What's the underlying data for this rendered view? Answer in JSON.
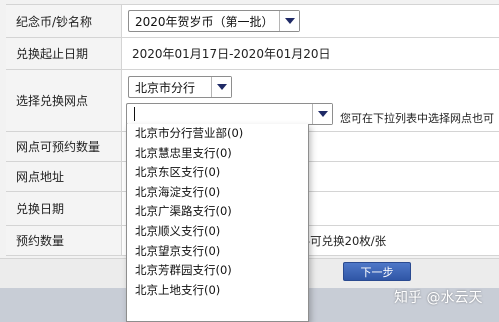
{
  "form": {
    "coin_name": {
      "label": "纪念币/钞名称",
      "selected": "2020年贺岁币（第一批）"
    },
    "period": {
      "label": "兑换起止日期",
      "value": "2020年01月17日-2020年01月20日"
    },
    "branch_select": {
      "label": "选择兑换网点",
      "city_selected": "北京市分行",
      "branch_value": "",
      "hint": "您可在下拉列表中选择网点也可"
    },
    "reserve_count": {
      "label": "网点可预约数量"
    },
    "address": {
      "label": "网点地址"
    },
    "exchange_date": {
      "label": "兑换日期"
    },
    "quantity": {
      "label": "预约数量",
      "note": "-可兑换20枚/张"
    }
  },
  "dropdown": {
    "options": [
      "北京市分行营业部(0)",
      "北京慧忠里支行(0)",
      "北京东区支行(0)",
      "北京海淀支行(0)",
      "北京广渠路支行(0)",
      "北京顺义支行(0)",
      "北京望京支行(0)",
      "北京芳群园支行(0)",
      "北京上地支行(0)"
    ]
  },
  "actions": {
    "next_label": "下一步"
  },
  "watermark": "知乎 @水云天"
}
